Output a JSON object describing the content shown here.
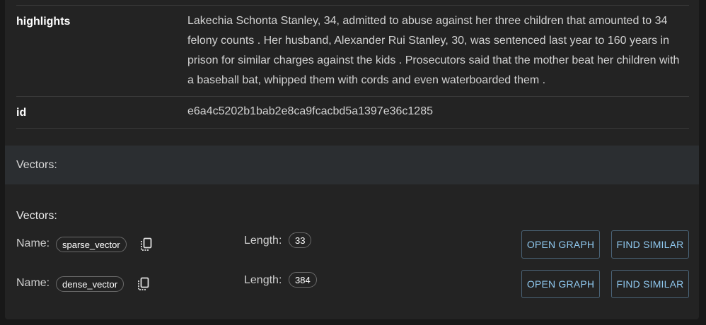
{
  "fields": [
    {
      "key": "highlights",
      "value": "Lakechia Schonta Stanley, 34, admitted to abuse against her three children that amounted to 34 felony counts . Her husband, Alexander Rui Stanley, 30, was sentenced last year to 160 years in prison for similar charges against the kids . Prosecutors said that the mother beat her children with a baseball bat, whipped them with cords and even waterboarded them ."
    },
    {
      "key": "id",
      "value": "e6a4c5202b1bab2e8ca9fcacbd5a1397e36c1285"
    }
  ],
  "vectors_band_label": "Vectors:",
  "vectors_title": "Vectors:",
  "vectors": [
    {
      "name_label": "Name:",
      "name": "sparse_vector",
      "length_label": "Length:",
      "length": "33",
      "open_graph_label": "OPEN GRAPH",
      "find_similar_label": "FIND SIMILAR"
    },
    {
      "name_label": "Name:",
      "name": "dense_vector",
      "length_label": "Length:",
      "length": "384",
      "open_graph_label": "OPEN GRAPH",
      "find_similar_label": "FIND SIMILAR"
    }
  ],
  "icons": {
    "copy": "copy-icon"
  },
  "colors": {
    "background": "#181818",
    "card": "#232323",
    "band": "#2b2e31",
    "button_text": "#8fc8ef",
    "button_border": "#4b6478"
  }
}
